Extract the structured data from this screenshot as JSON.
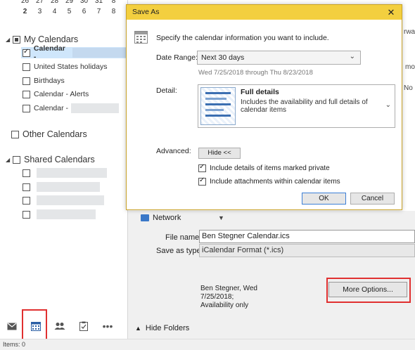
{
  "mini_calendar": {
    "row_prev": [
      "26",
      "27",
      "28",
      "29",
      "30",
      "31",
      "8"
    ],
    "row_days": [
      "2",
      "3",
      "4",
      "5",
      "6",
      "7",
      "8"
    ]
  },
  "my_calendars": {
    "header": "My Calendars",
    "items": [
      {
        "label": "Calendar -",
        "checked": true
      },
      {
        "label": "United States holidays",
        "checked": false
      },
      {
        "label": "Birthdays",
        "checked": false
      },
      {
        "label": "Calendar - Alerts",
        "checked": false
      },
      {
        "label": "Calendar -",
        "checked": false
      }
    ]
  },
  "other_calendars": {
    "header": "Other Calendars"
  },
  "shared_calendars": {
    "header": "Shared Calendars"
  },
  "nav": {
    "icons": [
      "mail-icon",
      "calendar-icon",
      "people-icon",
      "tasks-icon",
      "more-icon"
    ],
    "more_label": "•••"
  },
  "status_bar": {
    "text": "Items: 0"
  },
  "save_as_dialog": {
    "title": "Save As",
    "close_label": "✕",
    "intro": "Specify the calendar information you want to include.",
    "date_range_label": "Date Range:",
    "date_range_value": "Next 30 days",
    "date_range_hint": "Wed 7/25/2018 through Thu 8/23/2018",
    "detail_label": "Detail:",
    "detail_title": "Full details",
    "detail_description": "Includes the availability and full details of calendar items",
    "advanced_label": "Advanced:",
    "hide_button": "Hide <<",
    "option_private": "Include details of items marked private",
    "option_private_checked": true,
    "option_attachments": "Include attachments within calendar items",
    "option_attachments_checked": true,
    "ok_button": "OK",
    "cancel_button": "Cancel"
  },
  "file_dialog": {
    "edge_texts": [
      "rwa",
      "mo",
      "No"
    ],
    "network_label": "Network",
    "file_name_label": "File name:",
    "file_name_value": "Ben Stegner Calendar.ics",
    "save_as_type_label": "Save as type:",
    "save_as_type_value": "iCalendar Format (*.ics)",
    "author_info": "Ben Stegner, Wed 7/25/2018; Availability only",
    "more_options_button": "More Options...",
    "hide_folders_label": "Hide Folders"
  },
  "colors": {
    "title_bar": "#f3cf3f",
    "highlight": "#e03030",
    "selection": "#cfe6fb"
  }
}
